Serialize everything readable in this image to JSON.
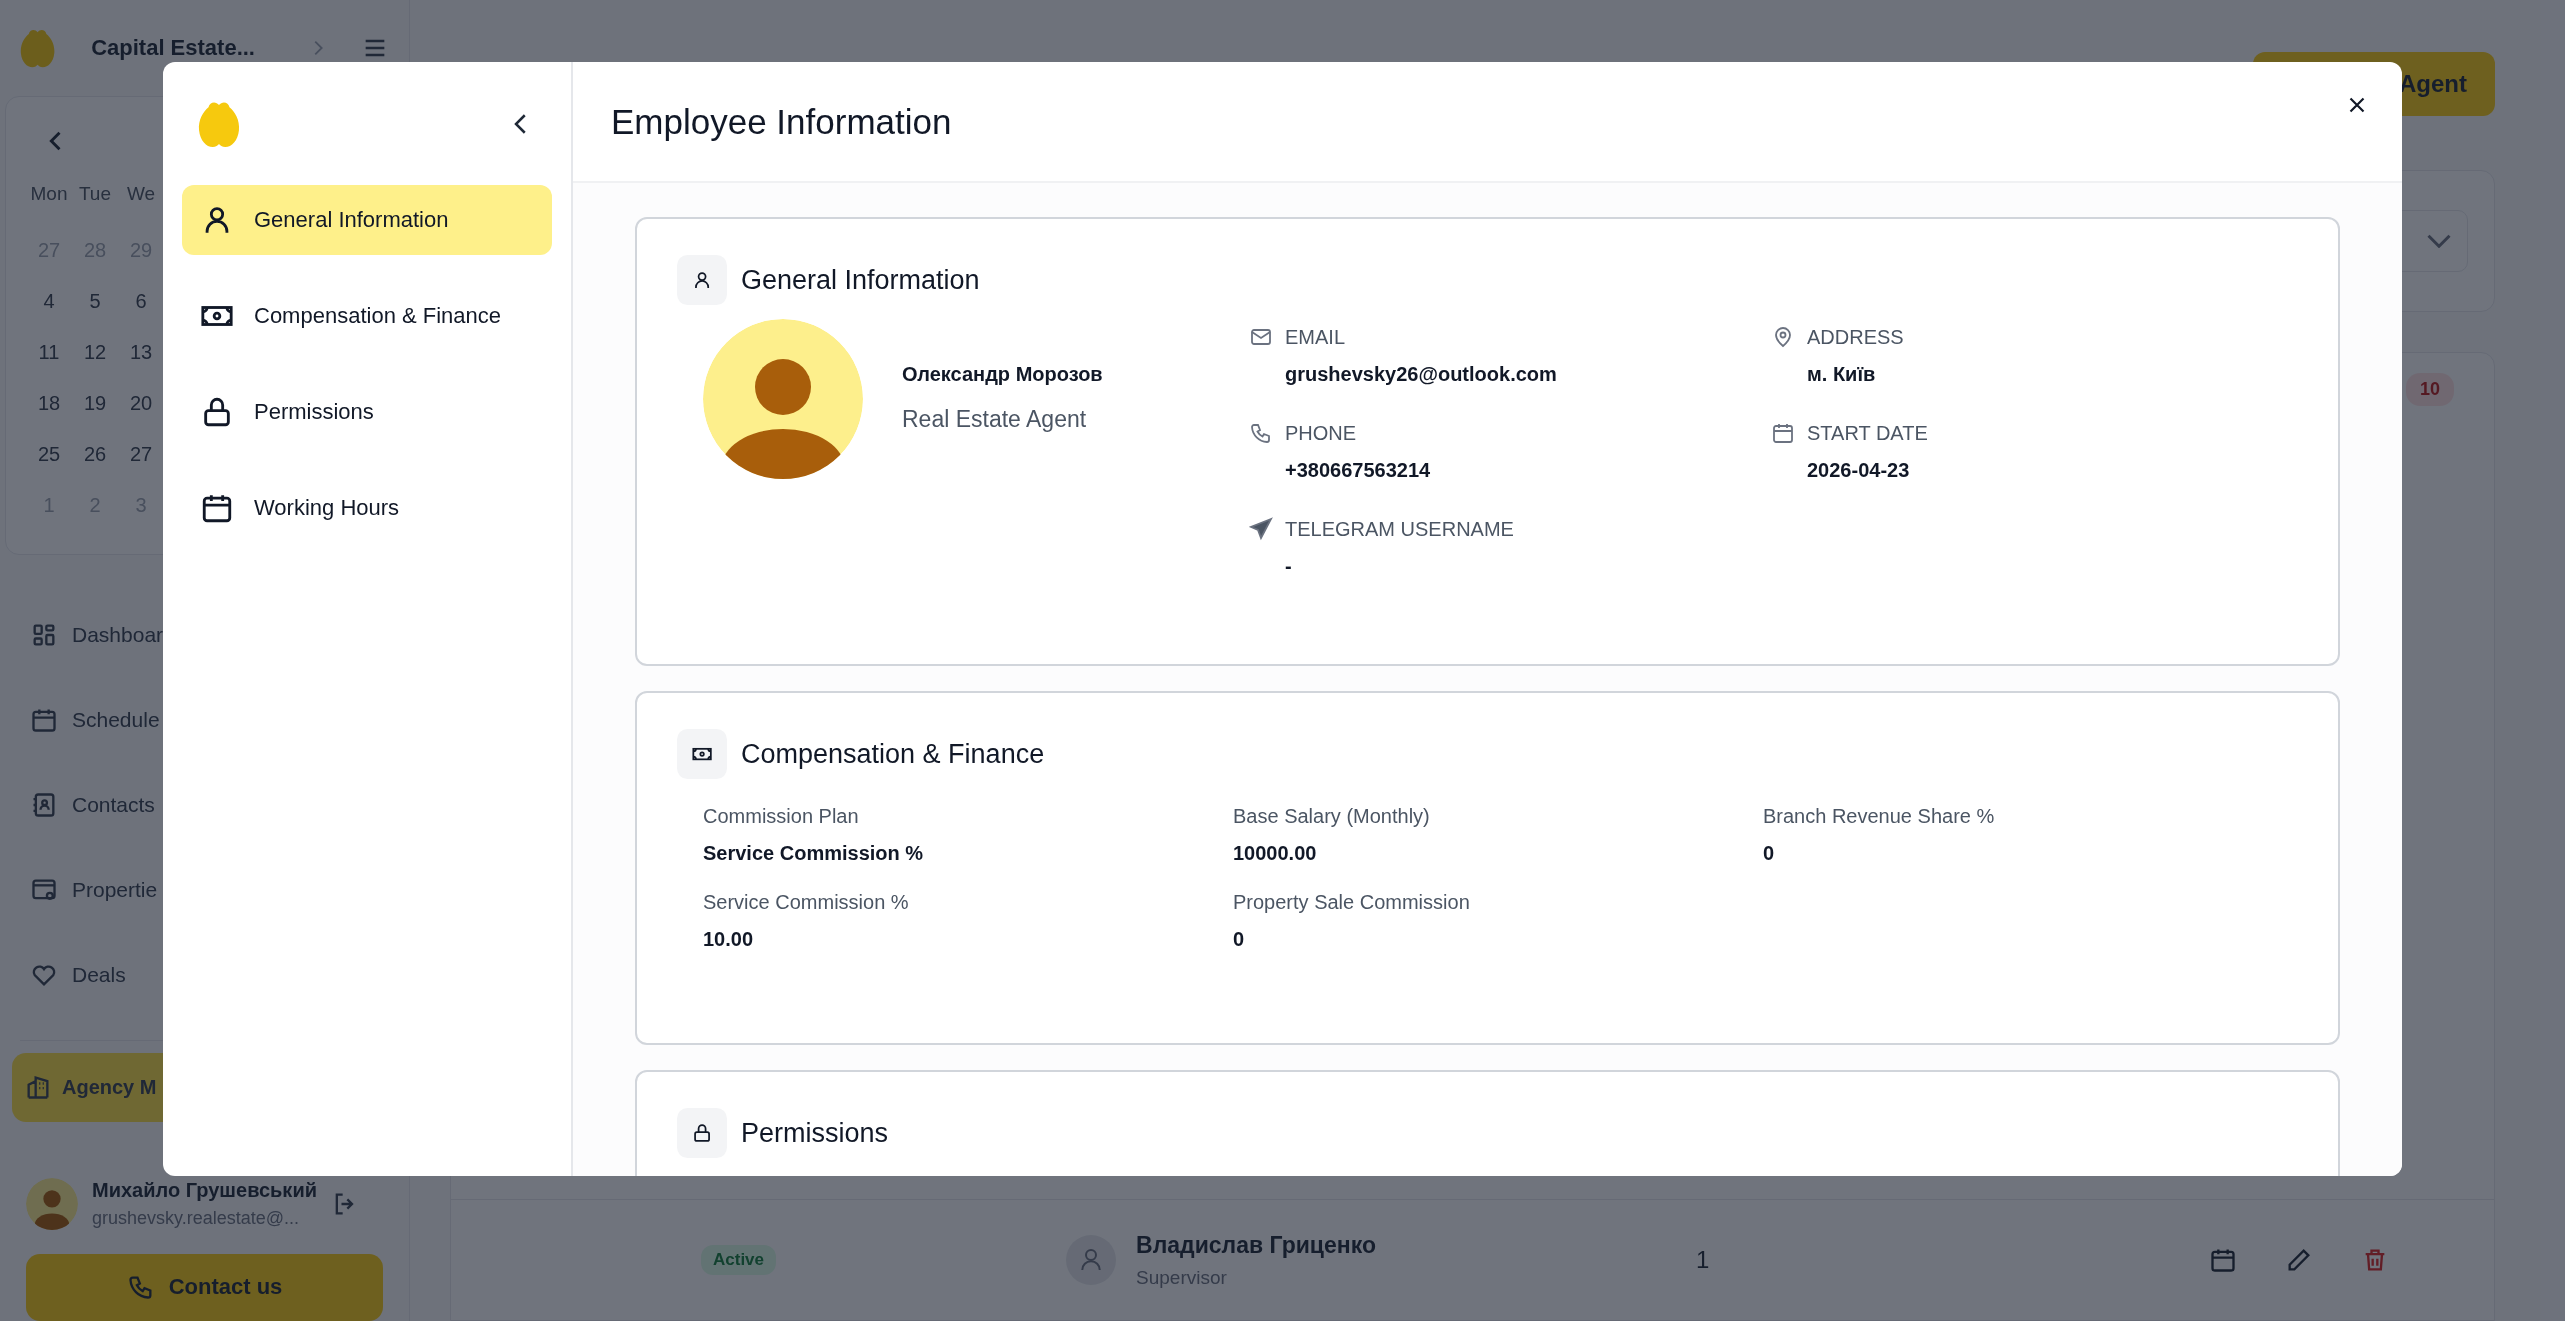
{
  "app": {
    "brand": "Capital Estate...",
    "calendar": {
      "weekdays": [
        "Mon",
        "Tue",
        "We"
      ],
      "weeks": [
        [
          {
            "day": "27",
            "muted": true
          },
          {
            "day": "28",
            "muted": true
          },
          {
            "day": "29",
            "muted": true
          }
        ],
        [
          {
            "day": "4",
            "muted": false
          },
          {
            "day": "5",
            "muted": false
          },
          {
            "day": "6",
            "muted": false
          }
        ],
        [
          {
            "day": "11",
            "muted": false
          },
          {
            "day": "12",
            "muted": false
          },
          {
            "day": "13",
            "muted": false
          }
        ],
        [
          {
            "day": "18",
            "muted": false
          },
          {
            "day": "19",
            "muted": false
          },
          {
            "day": "20",
            "muted": false
          }
        ],
        [
          {
            "day": "25",
            "muted": false
          },
          {
            "day": "26",
            "muted": false
          },
          {
            "day": "27",
            "muted": false
          }
        ],
        [
          {
            "day": "1",
            "muted": true
          },
          {
            "day": "2",
            "muted": true
          },
          {
            "day": "3",
            "muted": true
          }
        ]
      ]
    },
    "nav": [
      {
        "label": "Dashboar",
        "selected": false
      },
      {
        "label": "Schedule",
        "selected": false
      },
      {
        "label": "Contacts",
        "selected": false
      },
      {
        "label": "Propertie",
        "selected": false
      },
      {
        "label": "Deals",
        "selected": false
      }
    ],
    "admin_nav": [
      {
        "label": "Agency M",
        "selected": true
      }
    ],
    "user": {
      "name": "Михайло Грушевський",
      "email": "grushevsky.realestate@..."
    },
    "contact_button": "Contact us"
  },
  "page": {
    "add_button": "Agent",
    "count_badge": "10",
    "agent_row": {
      "status": "Active",
      "name": "Владислав Гриценко",
      "role": "Supervisor",
      "count": "1"
    }
  },
  "modal": {
    "title": "Employee Information",
    "nav": [
      {
        "label": "General Information",
        "selected": true
      },
      {
        "label": "Compensation & Finance",
        "selected": false
      },
      {
        "label": "Permissions",
        "selected": false
      },
      {
        "label": "Working Hours",
        "selected": false
      }
    ],
    "general": {
      "title": "General Information",
      "name": "Олександр Морозов",
      "role": "Real Estate Agent",
      "columns": [
        [
          {
            "label": "EMAIL",
            "value": "grushevsky26@outlook.com"
          },
          {
            "label": "PHONE",
            "value": "+380667563214"
          },
          {
            "label": "TELEGRAM USERNAME",
            "value": "-"
          }
        ],
        [
          {
            "label": "ADDRESS",
            "value": "м. Київ"
          },
          {
            "label": "START DATE",
            "value": "2026-04-23"
          }
        ]
      ]
    },
    "compensation": {
      "title": "Compensation & Finance",
      "fields": [
        {
          "label": "Commission Plan",
          "value": "Service Commission %"
        },
        {
          "label": "Base Salary (Monthly)",
          "value": "10000.00"
        },
        {
          "label": "Branch Revenue Share %",
          "value": "0"
        },
        {
          "label": "Service Commission %",
          "value": "10.00"
        },
        {
          "label": "Property Sale Commission",
          "value": "0"
        }
      ]
    },
    "permissions": {
      "title": "Permissions"
    }
  }
}
